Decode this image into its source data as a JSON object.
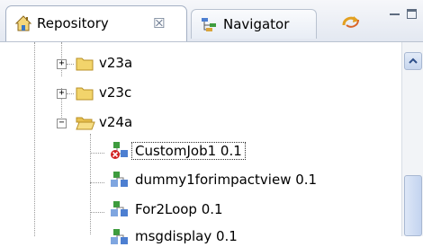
{
  "tabs": {
    "repository": {
      "label": "Repository",
      "icon": "home-icon",
      "close_glyph": "☒",
      "active": true
    },
    "navigator": {
      "label": "Navigator",
      "icon": "navigator-icon",
      "active": false
    }
  },
  "toolbar": {
    "sync_icon": "sync-icon",
    "minimize_icon": "minimize-icon",
    "maximize_icon": "maximize-icon"
  },
  "tree": {
    "folders": [
      {
        "label": "v23a",
        "expanded": false
      },
      {
        "label": "v23c",
        "expanded": false
      },
      {
        "label": "v24a",
        "expanded": true
      }
    ],
    "jobs": [
      {
        "label": "CustomJob1 0.1",
        "selected": true,
        "status": "error"
      },
      {
        "label": "dummy1forimpactview 0.1"
      },
      {
        "label": "For2Loop 0.1"
      },
      {
        "label": "msgdisplay 0.1"
      }
    ]
  },
  "colors": {
    "folder": "#f2d46b",
    "job_blue": "#4d7fd1",
    "job_green": "#3e9c3e",
    "error_red": "#d22020",
    "accent": "#b9c2d0"
  }
}
